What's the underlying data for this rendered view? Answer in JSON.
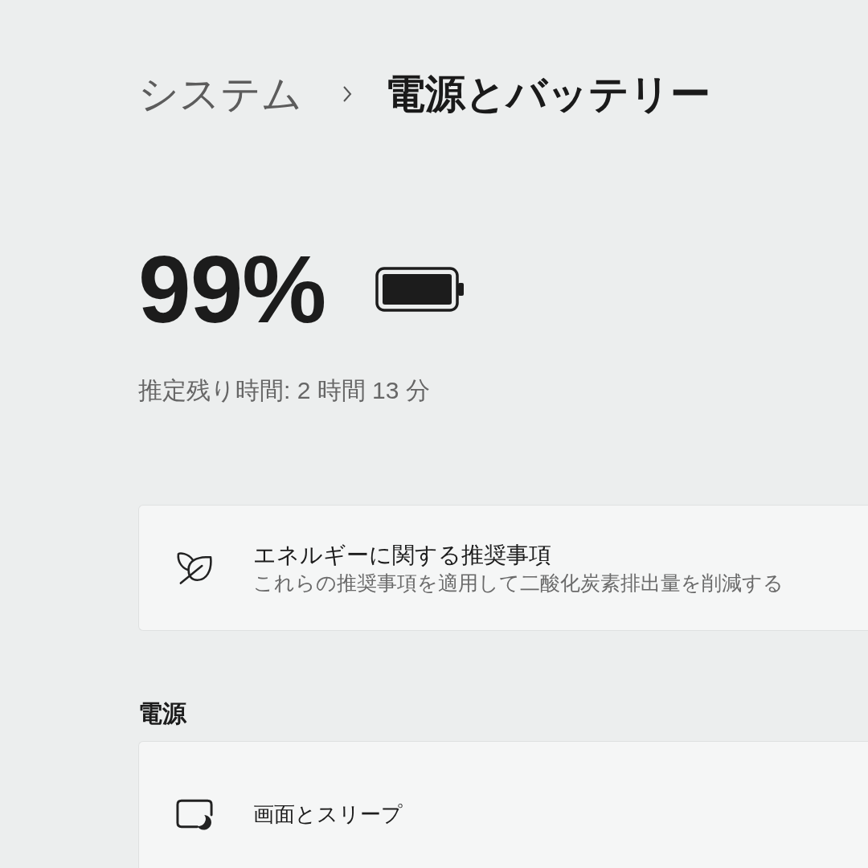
{
  "breadcrumb": {
    "parent": "システム",
    "current": "電源とバッテリー"
  },
  "battery": {
    "percentage": "99%",
    "time_remaining": "推定残り時間: 2 時間 13 分"
  },
  "recommendations_card": {
    "title": "エネルギーに関する推奨事項",
    "description": "これらの推奨事項を適用して二酸化炭素排出量を削減する"
  },
  "power_section": {
    "heading": "電源",
    "items": [
      {
        "title": "画面とスリープ"
      }
    ]
  }
}
